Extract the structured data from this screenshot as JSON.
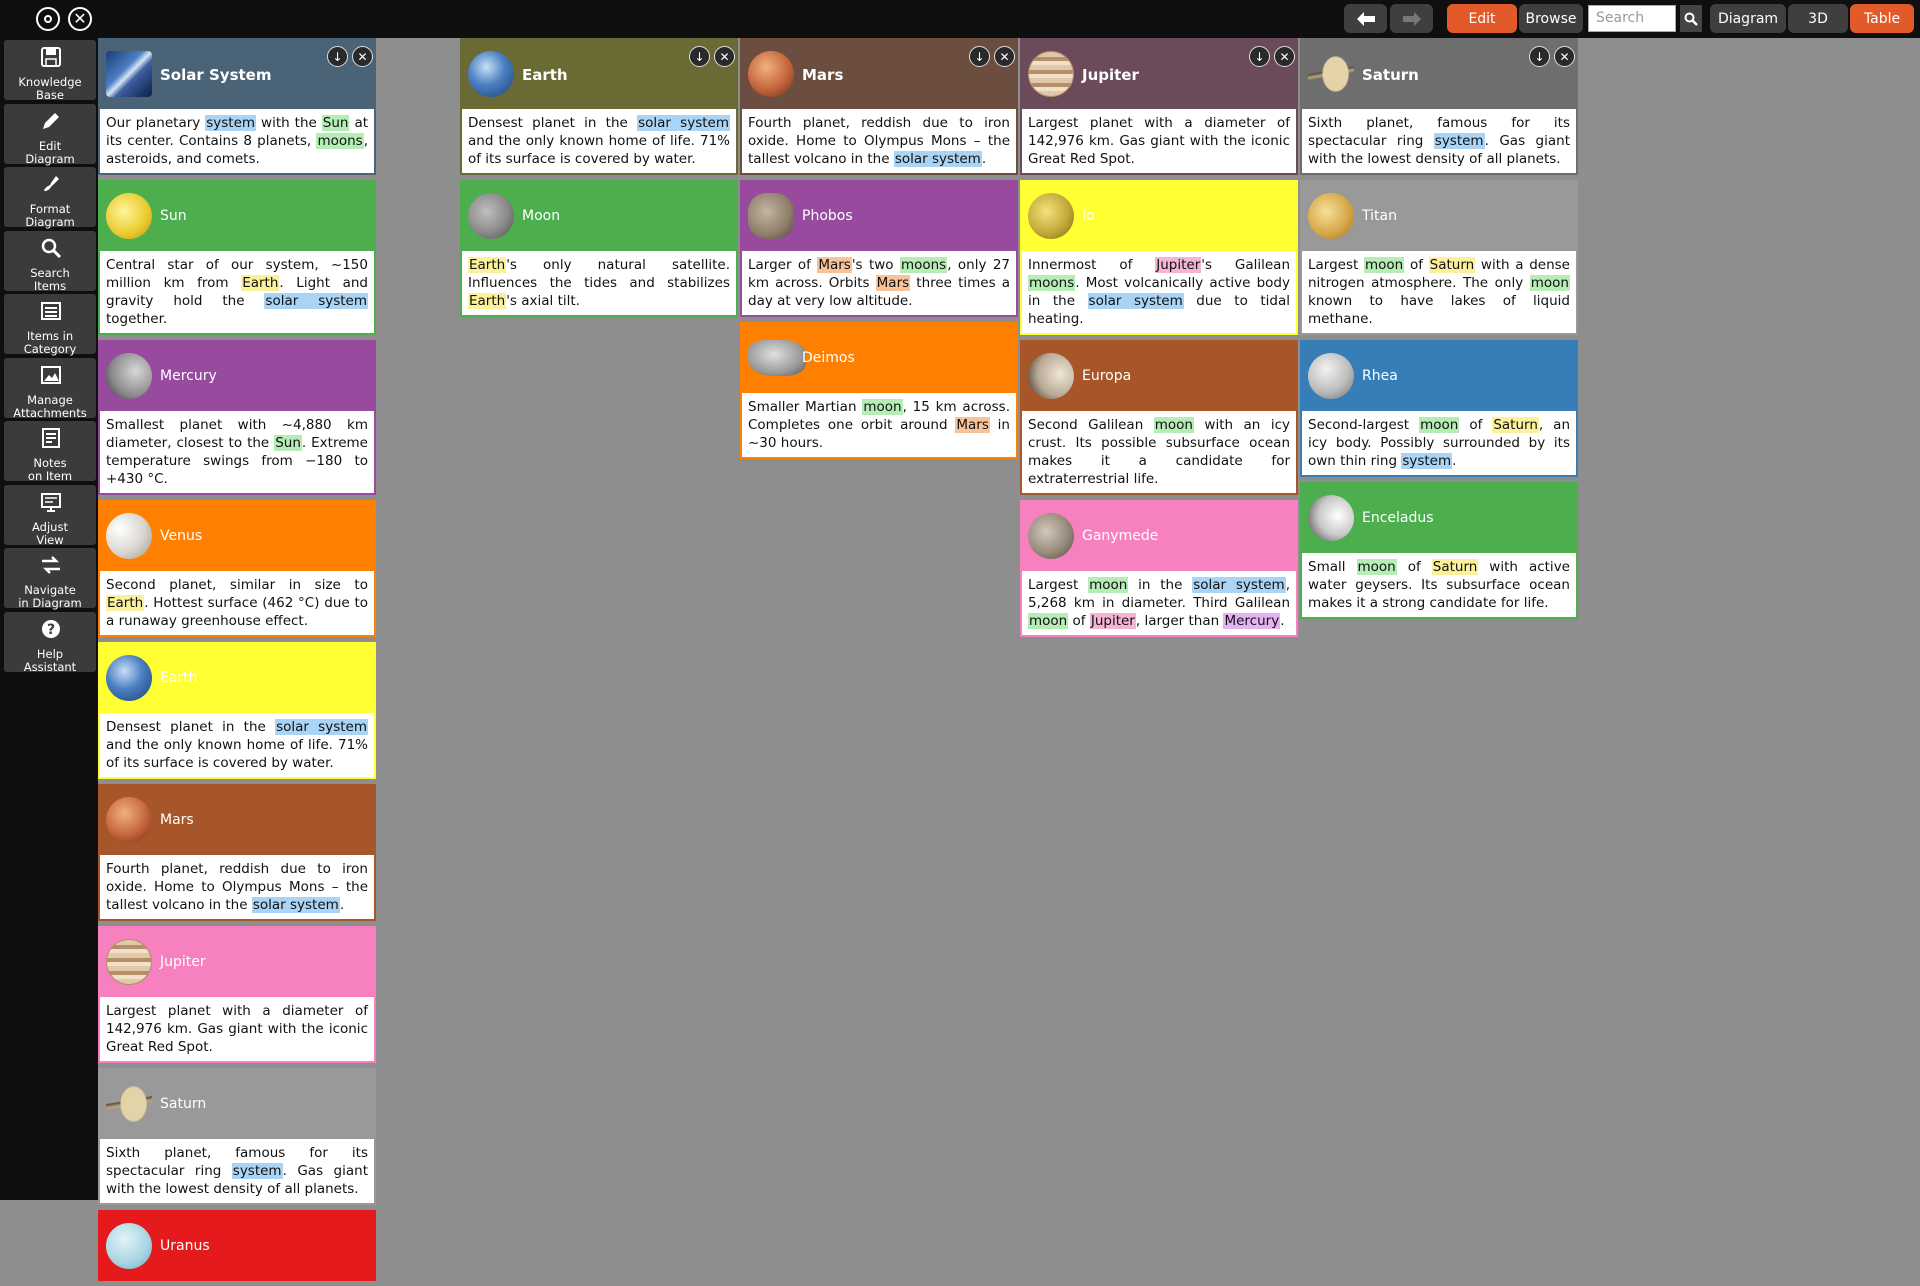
{
  "toolbar": {
    "edit": "Edit",
    "browse": "Browse",
    "search_placeholder": "Search",
    "diagram": "Diagram",
    "three_d": "3D",
    "table": "Table"
  },
  "sidebar": [
    {
      "name": "knowledge-base",
      "label1": "Knowledge",
      "label2": "Base"
    },
    {
      "name": "edit-diagram",
      "label1": "Edit",
      "label2": "Diagram"
    },
    {
      "name": "format-diagram",
      "label1": "Format",
      "label2": "Diagram"
    },
    {
      "name": "search-items",
      "label1": "Search",
      "label2": "Items"
    },
    {
      "name": "items-in-category",
      "label1": "Items in",
      "label2": "Category"
    },
    {
      "name": "manage-attachments",
      "label1": "Manage",
      "label2": "Attachments"
    },
    {
      "name": "notes-on-item",
      "label1": "Notes",
      "label2": "on Item"
    },
    {
      "name": "adjust-view",
      "label1": "Adjust",
      "label2": "View"
    },
    {
      "name": "navigate-in-diagram",
      "label1": "Navigate",
      "label2": "in Diagram"
    },
    {
      "name": "help-assistant",
      "label1": "Help",
      "label2": "Assistant"
    }
  ],
  "colors": {
    "blue": "#4a6377",
    "olive": "#6a6a35",
    "brown": "#6c4e40",
    "plum": "#6b4a5a",
    "grey": "#6e6e6e",
    "green": "#4cae4c",
    "purple": "#984a9f",
    "orange": "#ff7f00",
    "yellow": "#ffff33",
    "rust": "#a65628",
    "pink": "#f781bf",
    "silver": "#999999",
    "steel": "#377eb8",
    "red": "#e41a1c"
  },
  "columns": [
    {
      "cards": [
        {
          "title": "Solar System",
          "head": true,
          "color": "blue",
          "icon": "galaxy",
          "segs": [
            [
              "Our planetary "
            ],
            [
              "system",
              "blue"
            ],
            [
              " with the "
            ],
            [
              "Sun",
              "green"
            ],
            [
              " at its center. Contains 8 planets, "
            ],
            [
              "moons",
              "green"
            ],
            [
              ", asteroids, and comets."
            ]
          ]
        },
        {
          "title": "Sun",
          "color": "green",
          "icon": "sun",
          "segs": [
            [
              "Central star of our system, ~150 million km from "
            ],
            [
              "Earth",
              "yellow"
            ],
            [
              ". Light and gravity hold the "
            ],
            [
              "solar system",
              "blue"
            ],
            [
              " together."
            ]
          ]
        },
        {
          "title": "Mercury",
          "color": "purple",
          "icon": "mercury",
          "segs": [
            [
              "Smallest planet with ~4,880 km diameter, closest to the "
            ],
            [
              "Sun",
              "green"
            ],
            [
              ". Extreme temperature swings from −180 to +430 °C."
            ]
          ]
        },
        {
          "title": "Venus",
          "color": "orange",
          "icon": "venus",
          "segs": [
            [
              "Second planet, similar in size to "
            ],
            [
              "Earth",
              "yellow"
            ],
            [
              ". Hottest surface (462 °C) due to a runaway greenhouse effect."
            ]
          ]
        },
        {
          "title": "Earth",
          "color": "yellow",
          "icon": "earth",
          "segs": [
            [
              "Densest planet in the "
            ],
            [
              "solar system",
              "blue"
            ],
            [
              " and the only known home of life. 71% of its surface is covered by water."
            ]
          ]
        },
        {
          "title": "Mars",
          "color": "rust",
          "icon": "mars",
          "segs": [
            [
              "Fourth planet, reddish due to iron oxide. Home to Olympus Mons – the tallest volcano in the "
            ],
            [
              "solar system",
              "blue"
            ],
            [
              "."
            ]
          ]
        },
        {
          "title": "Jupiter",
          "color": "pink",
          "icon": "jupiter",
          "segs": [
            [
              "Largest planet with a diameter of 142,976 km. Gas giant with the iconic Great Red Spot."
            ]
          ]
        },
        {
          "title": "Saturn",
          "color": "silver",
          "icon": "saturn",
          "segs": [
            [
              "Sixth planet, famous for its spectacular ring "
            ],
            [
              "system",
              "blue"
            ],
            [
              ". Gas giant with the lowest density of all planets."
            ]
          ]
        },
        {
          "title": "Uranus",
          "color": "red",
          "icon": "uranus",
          "segs": []
        }
      ]
    },
    {
      "cards": [
        {
          "title": "Earth",
          "head": true,
          "color": "olive",
          "icon": "earth",
          "segs": [
            [
              "Densest planet in the "
            ],
            [
              "solar system",
              "blue"
            ],
            [
              " and the only known home of life. 71% of its surface is covered by water."
            ]
          ]
        },
        {
          "title": "Moon",
          "color": "green",
          "icon": "moon",
          "segs": [
            [
              "Earth",
              "yellow"
            ],
            [
              "'s only natural satellite. Influences the tides and stabilizes "
            ],
            [
              "Earth",
              "yellow"
            ],
            [
              "'s axial tilt."
            ]
          ]
        }
      ]
    },
    {
      "cards": [
        {
          "title": "Mars",
          "head": true,
          "color": "brown",
          "icon": "mars",
          "segs": [
            [
              "Fourth planet, reddish due to iron oxide. Home to Olympus Mons – the tallest volcano in the "
            ],
            [
              "solar system",
              "blue"
            ],
            [
              "."
            ]
          ]
        },
        {
          "title": "Phobos",
          "color": "purple",
          "icon": "phobos",
          "segs": [
            [
              "Larger of "
            ],
            [
              "Mars",
              "orange"
            ],
            [
              "'s two "
            ],
            [
              "moons",
              "green"
            ],
            [
              ", only 27 km across. Orbits "
            ],
            [
              "Mars",
              "orange"
            ],
            [
              " three times a day at very low altitude."
            ]
          ]
        },
        {
          "title": "Deimos",
          "color": "orange",
          "icon": "deimos",
          "segs": [
            [
              "Smaller Martian "
            ],
            [
              "moon",
              "green"
            ],
            [
              ", 15 km across. Completes one orbit around "
            ],
            [
              "Mars",
              "orange"
            ],
            [
              " in ~30 hours."
            ]
          ]
        }
      ]
    },
    {
      "cards": [
        {
          "title": "Jupiter",
          "head": true,
          "color": "plum",
          "icon": "jupiter",
          "segs": [
            [
              "Largest planet with a diameter of 142,976 km. Gas giant with the iconic Great Red Spot."
            ]
          ]
        },
        {
          "title": "Io",
          "color": "yellow",
          "icon": "io",
          "segs": [
            [
              "Innermost of "
            ],
            [
              "Jupiter",
              "pink"
            ],
            [
              "'s Galilean "
            ],
            [
              "moons",
              "green"
            ],
            [
              ". Most volcanically active body in the "
            ],
            [
              "solar system",
              "blue"
            ],
            [
              " due to tidal heating."
            ]
          ]
        },
        {
          "title": "Europa",
          "color": "rust",
          "icon": "europa",
          "segs": [
            [
              "Second Galilean "
            ],
            [
              "moon",
              "green"
            ],
            [
              " with an icy crust. Its possible subsurface ocean makes it a candidate for extraterrestrial life."
            ]
          ]
        },
        {
          "title": "Ganymede",
          "color": "pink",
          "icon": "ganymede",
          "segs": [
            [
              "Largest "
            ],
            [
              "moon",
              "green"
            ],
            [
              " in the "
            ],
            [
              "solar system",
              "blue"
            ],
            [
              ", 5,268 km in diameter. Third Galilean "
            ],
            [
              "moon",
              "green"
            ],
            [
              " of "
            ],
            [
              "Jupiter",
              "pink"
            ],
            [
              ", larger than "
            ],
            [
              "Mercury",
              "violet"
            ],
            [
              "."
            ]
          ]
        }
      ]
    },
    {
      "cards": [
        {
          "title": "Saturn",
          "head": true,
          "color": "grey",
          "icon": "saturn",
          "segs": [
            [
              "Sixth planet, famous for its spectacular ring "
            ],
            [
              "system",
              "blue"
            ],
            [
              ". Gas giant with the lowest density of all planets."
            ]
          ]
        },
        {
          "title": "Titan",
          "color": "silver",
          "icon": "titan",
          "segs": [
            [
              "Largest "
            ],
            [
              "moon",
              "green"
            ],
            [
              " of "
            ],
            [
              "Saturn",
              "yellow"
            ],
            [
              " with a dense nitrogen atmosphere. The only "
            ],
            [
              "moon",
              "green"
            ],
            [
              " known to have lakes of liquid methane."
            ]
          ]
        },
        {
          "title": "Rhea",
          "color": "steel",
          "icon": "rhea",
          "segs": [
            [
              "Second-largest "
            ],
            [
              "moon",
              "green"
            ],
            [
              " of "
            ],
            [
              "Saturn",
              "yellow"
            ],
            [
              ", an icy body. Possibly surrounded by its own thin ring "
            ],
            [
              "system",
              "blue"
            ],
            [
              "."
            ]
          ]
        },
        {
          "title": "Enceladus",
          "color": "green",
          "icon": "enceladus",
          "segs": [
            [
              "Small "
            ],
            [
              "moon",
              "green"
            ],
            [
              " of "
            ],
            [
              "Saturn",
              "yellow"
            ],
            [
              " with active water geysers. Its subsurface ocean makes it a strong candidate for life."
            ]
          ]
        }
      ]
    }
  ]
}
